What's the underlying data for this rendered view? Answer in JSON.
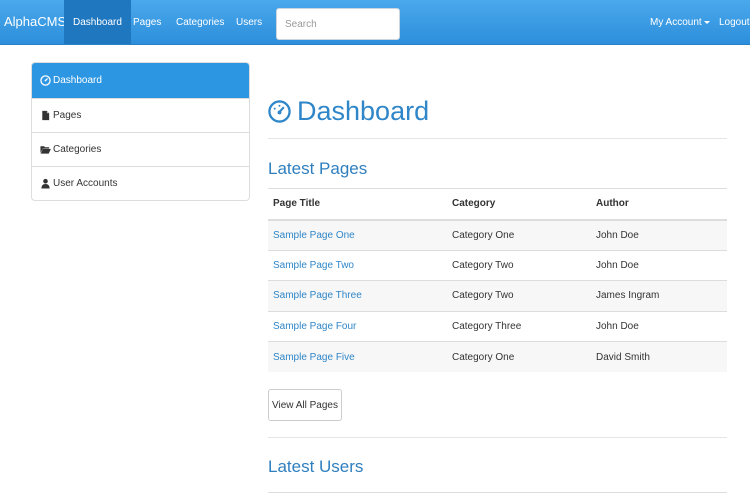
{
  "navbar": {
    "brand": "AlphaCMS",
    "links": [
      "Dashboard",
      "Pages",
      "Categories",
      "Users"
    ],
    "search_placeholder": "Search",
    "account": "My Account",
    "logout": "Logout",
    "color": "#2d8fdb"
  },
  "sidebar": {
    "items": [
      {
        "label": "Dashboard",
        "icon": "dashboard-icon"
      },
      {
        "label": "Pages",
        "icon": "file-icon"
      },
      {
        "label": "Categories",
        "icon": "folder-open-icon"
      },
      {
        "label": "User Accounts",
        "icon": "user-icon"
      }
    ]
  },
  "main": {
    "title": "Dashboard",
    "latest_pages_title": "Latest Pages",
    "columns": [
      "Page Title",
      "Category",
      "Author"
    ],
    "rows": [
      [
        "Sample Page One",
        "Category One",
        "John Doe"
      ],
      [
        "Sample Page Two",
        "Category Two",
        "John Doe"
      ],
      [
        "Sample Page Three",
        "Category Two",
        "James Ingram"
      ],
      [
        "Sample Page Four",
        "Category Three",
        "John Doe"
      ],
      [
        "Sample Page Five",
        "Category One",
        "David Smith"
      ]
    ],
    "view_all": "View All Pages",
    "latest_users_title": "Latest Users"
  }
}
